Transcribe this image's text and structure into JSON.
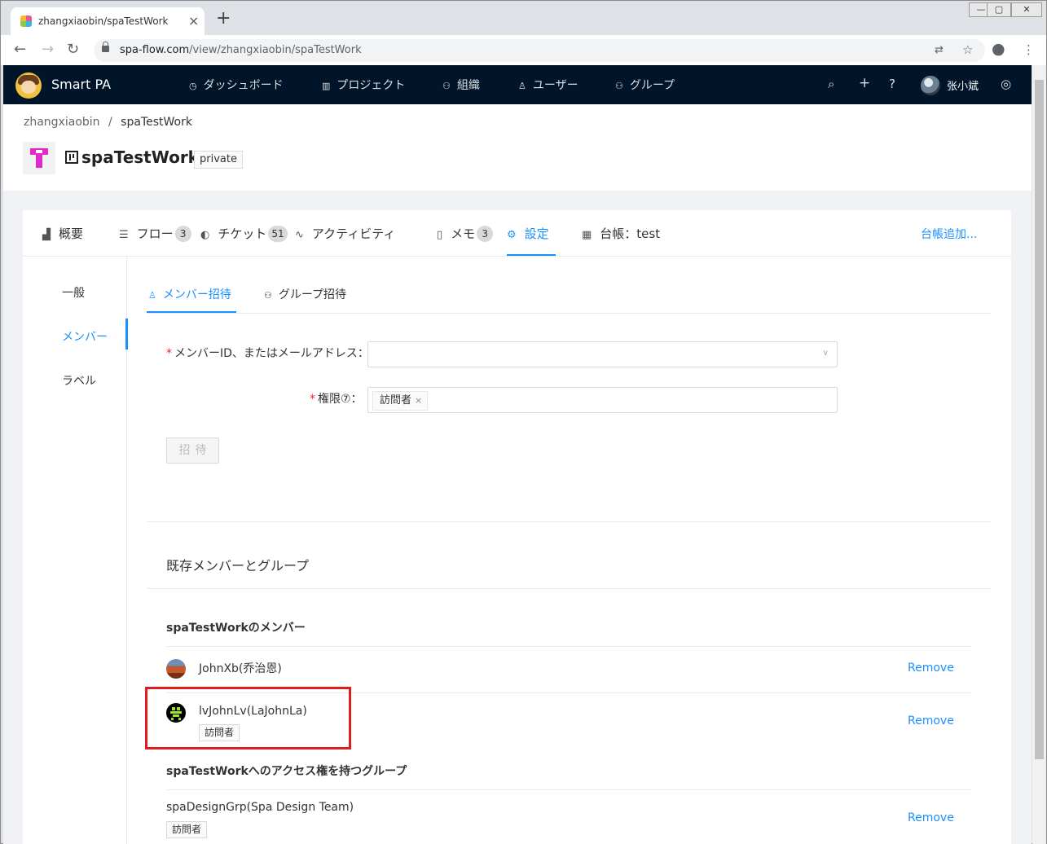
{
  "browser": {
    "tab_title": "zhangxiaobin/spaTestWork",
    "url_host": "spa-flow.com",
    "url_path": "/view/zhangxiaobin/spaTestWork"
  },
  "topnav": {
    "brand": "Smart PA",
    "menu": [
      {
        "label": "ダッシュボード",
        "icon": "dashboard-icon"
      },
      {
        "label": "プロジェクト",
        "icon": "project-icon"
      },
      {
        "label": "組織",
        "icon": "organization-icon"
      },
      {
        "label": "ユーザー",
        "icon": "user-icon"
      },
      {
        "label": "グループ",
        "icon": "group-icon"
      }
    ],
    "username": "张小斌"
  },
  "breadcrumb": {
    "owner": "zhangxiaobin",
    "separator": "/",
    "project": "spaTestWork"
  },
  "project": {
    "name": "spaTestWork",
    "visibility": "private"
  },
  "tabs": [
    {
      "label": "概要",
      "icon": "chart-icon"
    },
    {
      "label": "フロー",
      "icon": "flow-icon",
      "count": "3"
    },
    {
      "label": "チケット",
      "icon": "ticket-icon",
      "count": "51"
    },
    {
      "label": "アクティビティ",
      "icon": "activity-icon"
    },
    {
      "label": "メモ",
      "icon": "memo-icon",
      "count": "3"
    },
    {
      "label": "設定",
      "icon": "gear-icon",
      "active": true
    },
    {
      "label": "台帳：test",
      "icon": "table-icon"
    }
  ],
  "add_ledger": "台帳追加...",
  "settings_menu": [
    {
      "label": "一般"
    },
    {
      "label": "メンバー",
      "active": true
    },
    {
      "label": "ラベル"
    }
  ],
  "subtabs": [
    {
      "label": "メンバー招待",
      "active": true
    },
    {
      "label": "グループ招待"
    }
  ],
  "form": {
    "member_label": "メンバーID、またはメールアドレス：",
    "member_value": "",
    "permission_label": "権限⑦：",
    "permission_value": "訪問者",
    "invite_button": "招待"
  },
  "existing": {
    "title": "既存メンバーとグループ",
    "members_title": "spaTestWorkのメンバー",
    "members": [
      {
        "name": "JohnXb(乔治恩)",
        "role": "",
        "action": "Remove"
      },
      {
        "name": "lvJohnLv(LaJohnLa)",
        "role": "訪問者",
        "action": "Remove"
      }
    ],
    "groups_title": "spaTestWorkへのアクセス権を持つグループ",
    "groups": [
      {
        "name": "spaDesignGrp(Spa Design Team)",
        "role": "訪問者",
        "action": "Remove"
      }
    ]
  },
  "colors": {
    "nav_bg": "#001529",
    "accent": "#1890ff",
    "highlight": "#e01c1c",
    "required": "#f5222d"
  }
}
